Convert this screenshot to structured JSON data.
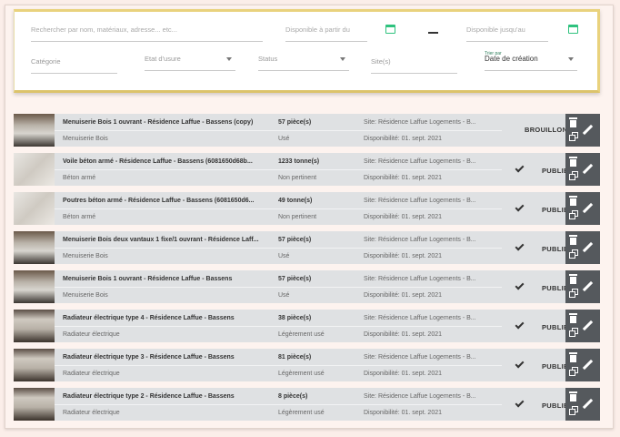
{
  "filters": {
    "search_placeholder": "Rechercher par nom, matériaux, adresse... etc...",
    "from_placeholder": "Disponible à partir du",
    "to_placeholder": "Disponible jusqu'au",
    "category_placeholder": "Catégorie",
    "wear_placeholder": "Etat d'usure",
    "status_placeholder": "Status",
    "site_placeholder": "Site(s)",
    "sort_label": "Trier par",
    "sort_value": "Date de création"
  },
  "rows": [
    {
      "title": "Menuiserie Bois 1 ouvrant - Résidence Laffue - Bassens (copy)",
      "category": "Menuiserie Bois",
      "quantity": "57 pièce(s)",
      "wear": "Usé",
      "site": "Site: Résidence Laffue Logements - B...",
      "availability": "Disponibilité: 01. sept. 2021",
      "status": "BROUILLON",
      "thumb": "wood"
    },
    {
      "title": "Voile béton armé - Résidence Laffue - Bassens (6081650d68b...",
      "category": "Béton armé",
      "quantity": "1233 tonne(s)",
      "wear": "Non pertinent",
      "site": "Site: Résidence Laffue Logements - B...",
      "availability": "Disponibilité: 01. sept. 2021",
      "status": "PUBLIÉ",
      "thumb": "concrete"
    },
    {
      "title": "Poutres béton armé - Résidence Laffue - Bassens (6081650d6...",
      "category": "Béton armé",
      "quantity": "49 tonne(s)",
      "wear": "Non pertinent",
      "site": "Site: Résidence Laffue Logements - B...",
      "availability": "Disponibilité: 01. sept. 2021",
      "status": "PUBLIÉ",
      "thumb": "concrete"
    },
    {
      "title": "Menuiserie Bois deux vantaux 1 fixe/1 ouvrant - Résidence Laff...",
      "category": "Menuiserie Bois",
      "quantity": "57 pièce(s)",
      "wear": "Usé",
      "site": "Site: Résidence Laffue Logements - B...",
      "availability": "Disponibilité: 01. sept. 2021",
      "status": "PUBLIÉ",
      "thumb": "wood"
    },
    {
      "title": "Menuiserie Bois 1 ouvrant - Résidence Laffue - Bassens",
      "category": "Menuiserie Bois",
      "quantity": "57 pièce(s)",
      "wear": "Usé",
      "site": "Site: Résidence Laffue Logements - B...",
      "availability": "Disponibilité: 01. sept. 2021",
      "status": "PUBLIÉ",
      "thumb": "wood"
    },
    {
      "title": "Radiateur électrique type 4 - Résidence Laffue - Bassens",
      "category": "Radiateur électrique",
      "quantity": "38 pièce(s)",
      "wear": "Légèrement usé",
      "site": "Site: Résidence Laffue Logements - B...",
      "availability": "Disponibilité: 01. sept. 2021",
      "status": "PUBLIÉ",
      "thumb": "rad"
    },
    {
      "title": "Radiateur électrique type 3 - Résidence Laffue - Bassens",
      "category": "Radiateur électrique",
      "quantity": "81 pièce(s)",
      "wear": "Légèrement usé",
      "site": "Site: Résidence Laffue Logements - B...",
      "availability": "Disponibilité: 01. sept. 2021",
      "status": "PUBLIÉ",
      "thumb": "rad"
    },
    {
      "title": "Radiateur électrique type 2 - Résidence Laffue - Bassens",
      "category": "Radiateur électrique",
      "quantity": "8 pièce(s)",
      "wear": "Légèrement usé",
      "site": "Site: Résidence Laffue Logements - B...",
      "availability": "Disponibilité: 01. sept. 2021",
      "status": "PUBLIÉ",
      "thumb": "rad"
    }
  ],
  "colors": {
    "accent_green": "#2ec27e",
    "filter_border": "#e9d27d",
    "row_bg": "#dfe1e3",
    "actions_bg": "#55595d",
    "page_bg": "#fdf3ef"
  }
}
